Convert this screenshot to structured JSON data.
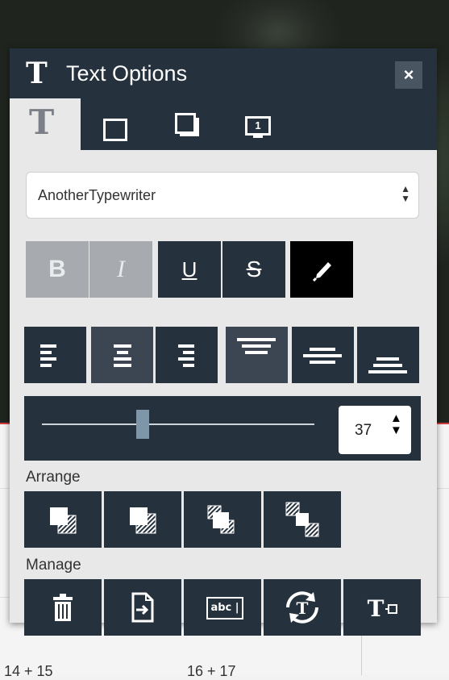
{
  "panel": {
    "title": "Text Options",
    "title_icon": "T",
    "close_label": "×"
  },
  "tabs": [
    {
      "name": "text-tab",
      "icon": "text-T-icon",
      "glyph": "T"
    },
    {
      "name": "border-tab",
      "icon": "square-outline-icon"
    },
    {
      "name": "shadow-tab",
      "icon": "shadow-box-icon"
    },
    {
      "name": "display-tab",
      "icon": "screen-icon",
      "glyph": "1"
    }
  ],
  "font": {
    "value": "AnotherTypewriter",
    "arrows": "▲▼"
  },
  "style_buttons": {
    "bold": "B",
    "italic": "I",
    "underline": "U",
    "strike": "S",
    "color_icon": "paint-brush-icon"
  },
  "size": {
    "value": "37",
    "level_fraction": 0.37,
    "arrows": "▲▼"
  },
  "arrange": {
    "label": "Arrange",
    "buttons": [
      "bring-to-front",
      "bring-forward",
      "send-backward",
      "send-to-back"
    ]
  },
  "manage": {
    "label": "Manage",
    "buttons": [
      "delete",
      "export",
      "textbox",
      "refresh-text",
      "text-field"
    ],
    "textbox_glyph": "abc",
    "field_glyph": "T"
  },
  "background": {
    "label_left": "14 + 15",
    "label_right": "16 + 17"
  },
  "colors": {
    "panel_dark": "#25313d",
    "panel_light": "#e8e8e8",
    "disabled": "#a7aaae",
    "slider_thumb": "#7d96a8",
    "accent_red": "#d23b3b"
  }
}
